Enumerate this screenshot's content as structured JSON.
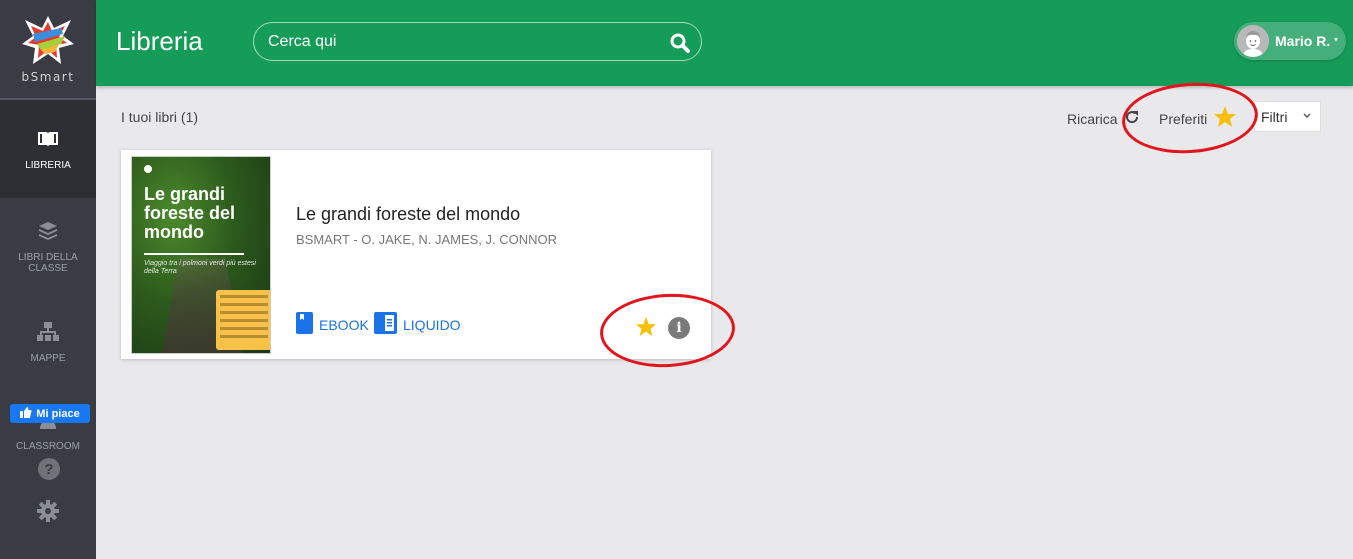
{
  "sidebar": {
    "brand": "bSmart",
    "items": [
      {
        "label": "LIBRERIA",
        "icon": "open-book-icon",
        "active": true
      },
      {
        "label": "LIBRI DELLA CLASSE",
        "icon": "stacked-books-icon",
        "active": false
      },
      {
        "label": "MAPPE",
        "icon": "sitemap-icon",
        "active": false
      },
      {
        "label": "CLASSROOM",
        "icon": "users-icon",
        "active": false
      },
      {
        "label": "",
        "icon": "gear-icon",
        "active": false
      }
    ],
    "like_button": "Mi piace",
    "help_glyph": "?"
  },
  "header": {
    "title": "Libreria",
    "search_placeholder": "Cerca qui",
    "user_name": "Mario R.",
    "user_caret": "▾"
  },
  "toolbar": {
    "count_label": "I tuoi libri (1)",
    "reload_label": "Ricarica",
    "favorites_label": "Preferiti",
    "filters_label": "Filtri",
    "filters_caret": "⌄"
  },
  "books": [
    {
      "title": "Le grandi foreste del mondo",
      "authors": "BSMART - O. JAKE, N. JAMES, J. CONNOR",
      "cover_title": "Le grandi foreste del mondo",
      "cover_subtitle": "Viaggio tra i polmoni verdi più estesi della Terra",
      "formats": [
        "EBOOK",
        "LIQUIDO"
      ],
      "favorite": true,
      "info_glyph": "i"
    }
  ],
  "colors": {
    "header": "#169c59",
    "sidebar": "#393c43",
    "accent_link": "#1a73e8",
    "star": "#f7bf09",
    "annotation": "#e0161c"
  }
}
